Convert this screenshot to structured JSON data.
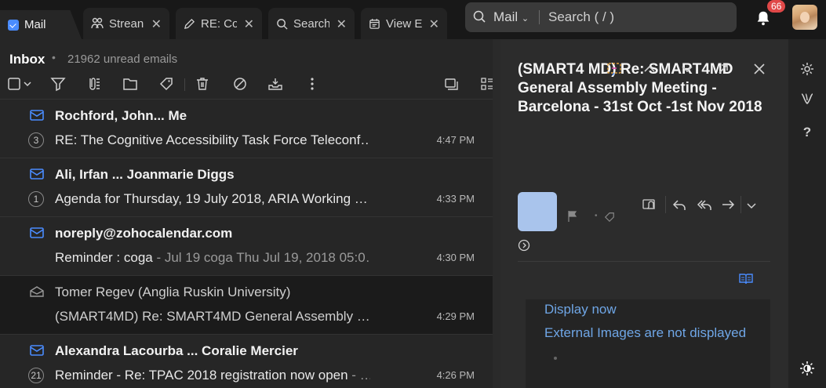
{
  "tabs": [
    {
      "label": "Mail",
      "icon": "mail-app-icon",
      "active": true
    },
    {
      "label": "Strean",
      "icon": "streams-icon"
    },
    {
      "label": "RE: Co",
      "icon": "pencil-icon"
    },
    {
      "label": "Search",
      "icon": "search-icon"
    },
    {
      "label": "View E",
      "icon": "calendar-icon"
    }
  ],
  "search": {
    "scope": "Mail",
    "placeholder": "Search ( / )"
  },
  "notifications": {
    "badge": "66"
  },
  "inbox": {
    "title": "Inbox",
    "dot": "•",
    "unread": "21962 unread emails"
  },
  "emails": [
    {
      "sender": "Rochford, John... Me",
      "count": "3",
      "subject": "RE: The Cognitive Accessibility Task Force Teleconf…",
      "snippet": "",
      "time": "4:47 PM",
      "unread": true
    },
    {
      "sender": "Ali, Irfan ... Joanmarie Diggs",
      "count": "1",
      "subject": "Agenda for Thursday, 19 July 2018, ARIA Working …",
      "snippet": "",
      "time": "4:33 PM",
      "unread": true
    },
    {
      "sender": "noreply@zohocalendar.com",
      "count": "",
      "subject": "Reminder : coga",
      "snippet": " - Jul 19 coga Thu Jul 19, 2018 05:0…",
      "time": "4:30 PM",
      "unread": true
    },
    {
      "sender": "Tomer Regev (Anglia Ruskin University)",
      "count": "",
      "subject": "(SMART4MD) Re: SMART4MD General Assembly …",
      "snippet": "",
      "time": "4:29 PM",
      "unread": false
    },
    {
      "sender": "Alexandra Lacourba ... Coralie Mercier",
      "count": "21",
      "subject": "Reminder - Re: TPAC 2018 registration now open",
      "snippet": " - …",
      "time": "4:26 PM",
      "unread": true
    }
  ],
  "preview": {
    "title": "(SMART4 MD) Re: SMART4MD General Assembly Meeting - Barcelona - 31st Oct -1st Nov 2018",
    "display_now": "Display now",
    "external_images": "External Images are not displayed"
  },
  "colors": {
    "accent": "#4a8cff",
    "link": "#6fa6e6",
    "badge": "#e04848"
  }
}
